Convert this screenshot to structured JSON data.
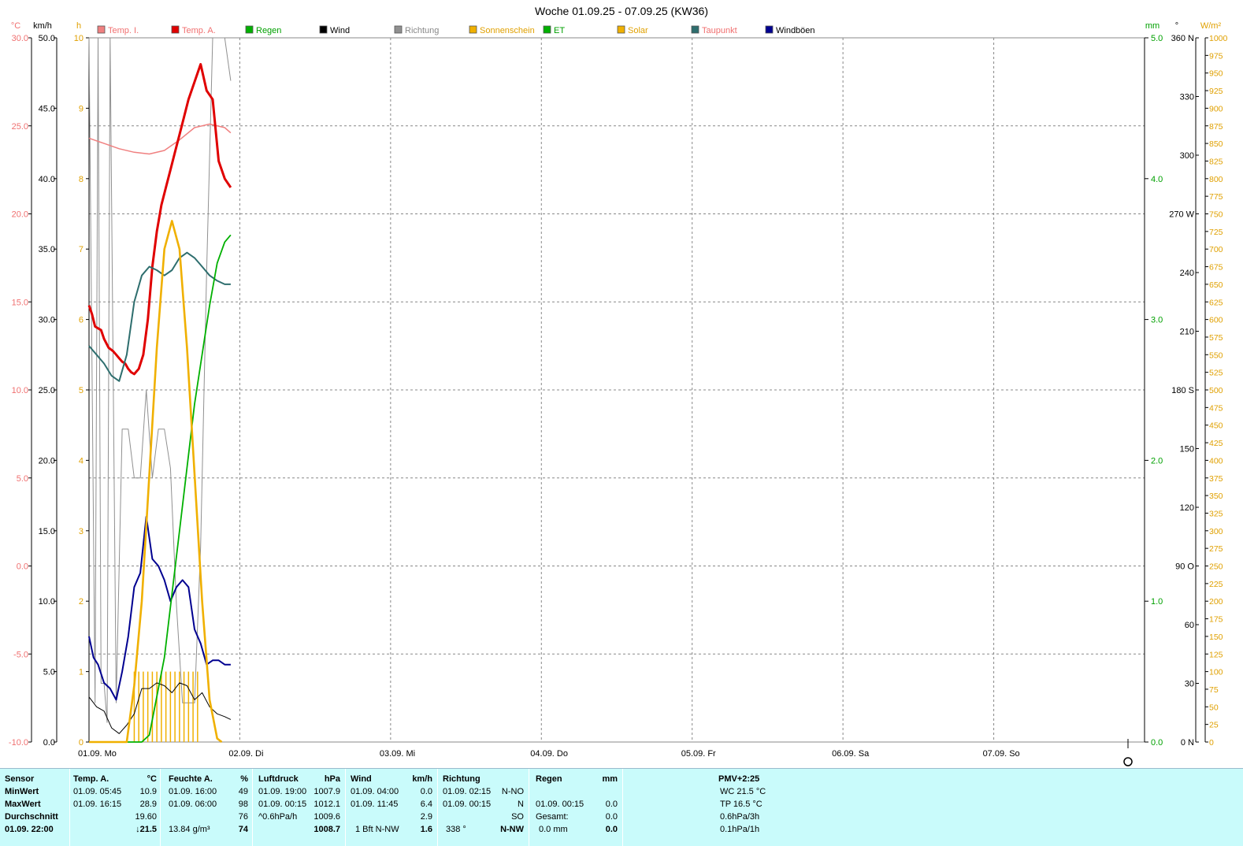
{
  "title": "Woche 01.09.25 - 07.09.25 (KW36)",
  "units": {
    "temp": "°C",
    "wind": "km/h",
    "hours": "h",
    "rain": "mm",
    "deg": "°",
    "solar": "W/m²"
  },
  "legend": [
    {
      "label": "Temp. I.",
      "color": "#f08080"
    },
    {
      "label": "Temp. A.",
      "color": "#e00000"
    },
    {
      "label": "Regen",
      "color": "#00b000"
    },
    {
      "label": "Wind",
      "color": "#000000"
    },
    {
      "label": "Richtung",
      "color": "#909090"
    },
    {
      "label": "Sonnenschein",
      "color": "#f0b000"
    },
    {
      "label": "ET",
      "color": "#00b000"
    },
    {
      "label": "Solar",
      "color": "#f0b000"
    },
    {
      "label": "Taupunkt",
      "color": "#2e6e6e"
    },
    {
      "label": "Windböen",
      "color": "#000090"
    }
  ],
  "chart_data": {
    "type": "line",
    "x_days": [
      "01.09.  Mo",
      "02.09.  Di",
      "03.09.  Mi",
      "04.09.  Do",
      "05.09.  Fr",
      "06.09.  Sa",
      "07.09.  So"
    ],
    "axes": {
      "temp": {
        "range": [
          -10,
          30
        ],
        "ticks": [
          "30.0",
          "25.0",
          "20.0",
          "15.0",
          "10.0",
          "5.0",
          "0.0",
          "-5.0",
          "-10.0"
        ]
      },
      "wind": {
        "range": [
          0,
          50
        ],
        "ticks": [
          "50.0",
          "45.0",
          "40.0",
          "35.0",
          "30.0",
          "25.0",
          "20.0",
          "15.0",
          "10.0",
          "5.0",
          "0.0"
        ]
      },
      "hours": {
        "range": [
          0,
          10
        ],
        "ticks": [
          "10",
          "9",
          "8",
          "7",
          "6",
          "5",
          "4",
          "3",
          "2",
          "1",
          "0"
        ]
      },
      "rain": {
        "range": [
          0,
          5
        ],
        "ticks": [
          "5.0",
          "4.0",
          "3.0",
          "2.0",
          "1.0",
          "0.0"
        ]
      },
      "direction": {
        "range": [
          0,
          360
        ],
        "ticks": [
          {
            "v": 360,
            "t": "360 N"
          },
          {
            "v": 330,
            "t": "330"
          },
          {
            "v": 300,
            "t": "300"
          },
          {
            "v": 270,
            "t": "270 W"
          },
          {
            "v": 240,
            "t": "240"
          },
          {
            "v": 210,
            "t": "210"
          },
          {
            "v": 180,
            "t": "180 S"
          },
          {
            "v": 150,
            "t": "150"
          },
          {
            "v": 120,
            "t": "120"
          },
          {
            "v": 90,
            "t": "90  O"
          },
          {
            "v": 60,
            "t": "60"
          },
          {
            "v": 30,
            "t": "30"
          },
          {
            "v": 0,
            "t": "0   N"
          }
        ]
      },
      "solar": {
        "range": [
          0,
          1000
        ],
        "step": 25
      }
    },
    "series": [
      {
        "name": "Temp. I.",
        "axis": "temp",
        "x": [
          0,
          0.1,
          0.2,
          0.3,
          0.4,
          0.5,
          0.6,
          0.7,
          0.8,
          0.9,
          0.94
        ],
        "values": [
          24.3,
          24.0,
          23.7,
          23.5,
          23.4,
          23.6,
          24.2,
          24.9,
          25.1,
          24.9,
          24.6
        ]
      },
      {
        "name": "Temp. A.",
        "axis": "temp",
        "x": [
          0,
          0.02,
          0.04,
          0.06,
          0.08,
          0.1,
          0.13,
          0.16,
          0.18,
          0.2,
          0.22,
          0.24,
          0.26,
          0.28,
          0.3,
          0.33,
          0.36,
          0.39,
          0.42,
          0.45,
          0.48,
          0.51,
          0.54,
          0.57,
          0.6,
          0.63,
          0.66,
          0.7,
          0.74,
          0.78,
          0.82,
          0.86,
          0.9,
          0.94
        ],
        "values": [
          14.8,
          14.3,
          13.6,
          13.5,
          13.4,
          12.9,
          12.4,
          12.2,
          12.0,
          11.8,
          11.6,
          11.5,
          11.2,
          11.0,
          10.9,
          11.2,
          12.0,
          14.0,
          17.0,
          19.0,
          20.5,
          21.5,
          22.5,
          23.5,
          24.5,
          25.5,
          26.5,
          27.5,
          28.5,
          27.0,
          26.5,
          23.0,
          22.0,
          21.5
        ]
      },
      {
        "name": "Taupunkt",
        "axis": "temp",
        "x": [
          0,
          0.05,
          0.1,
          0.15,
          0.2,
          0.25,
          0.3,
          0.35,
          0.4,
          0.45,
          0.5,
          0.55,
          0.6,
          0.65,
          0.7,
          0.75,
          0.8,
          0.85,
          0.9,
          0.94
        ],
        "values": [
          12.5,
          12.0,
          11.5,
          10.8,
          10.5,
          12.0,
          15.0,
          16.5,
          17.0,
          16.8,
          16.5,
          16.8,
          17.5,
          17.8,
          17.5,
          17.0,
          16.5,
          16.2,
          16.0,
          16.0
        ]
      },
      {
        "name": "ET",
        "axis": "rain",
        "x": [
          0,
          0.35,
          0.4,
          0.5,
          0.6,
          0.7,
          0.8,
          0.85,
          0.9,
          0.94
        ],
        "values": [
          0,
          0,
          0.05,
          0.6,
          1.5,
          2.4,
          3.1,
          3.4,
          3.55,
          3.6
        ]
      },
      {
        "name": "Solar",
        "axis": "solar",
        "x": [
          0,
          0.25,
          0.3,
          0.35,
          0.4,
          0.45,
          0.5,
          0.55,
          0.6,
          0.65,
          0.7,
          0.75,
          0.8,
          0.85,
          0.88
        ],
        "values": [
          0,
          0,
          80,
          200,
          380,
          560,
          700,
          740,
          700,
          560,
          380,
          200,
          60,
          5,
          0
        ]
      }
    ],
    "wind": {
      "axis": "wind",
      "x": [
        0,
        0.05,
        0.1,
        0.15,
        0.2,
        0.25,
        0.3,
        0.35,
        0.4,
        0.45,
        0.5,
        0.55,
        0.6,
        0.65,
        0.7,
        0.75,
        0.8,
        0.85,
        0.9,
        0.94
      ],
      "values": [
        3.2,
        2.5,
        2.2,
        1.0,
        0.6,
        1.2,
        2.0,
        3.8,
        3.8,
        4.2,
        4.0,
        3.5,
        4.2,
        4.0,
        3.0,
        3.5,
        2.5,
        2.0,
        1.8,
        1.6
      ]
    },
    "gusts": {
      "axis": "wind",
      "x": [
        0,
        0.03,
        0.06,
        0.1,
        0.14,
        0.18,
        0.22,
        0.26,
        0.3,
        0.34,
        0.38,
        0.42,
        0.46,
        0.5,
        0.54,
        0.58,
        0.62,
        0.66,
        0.7,
        0.74,
        0.78,
        0.82,
        0.86,
        0.9,
        0.94
      ],
      "values": [
        7.5,
        6.0,
        5.5,
        4.2,
        3.8,
        3.0,
        5.0,
        7.5,
        11.0,
        12.0,
        16.0,
        13.0,
        12.5,
        11.5,
        10.0,
        11.0,
        11.5,
        11.0,
        8.0,
        7.0,
        5.5,
        5.8,
        5.8,
        5.5,
        5.5
      ]
    },
    "direction": {
      "axis": "direction",
      "x": [
        0,
        0.04,
        0.06,
        0.08,
        0.1,
        0.12,
        0.14,
        0.18,
        0.22,
        0.26,
        0.3,
        0.34,
        0.38,
        0.42,
        0.46,
        0.5,
        0.54,
        0.58,
        0.62,
        0.66,
        0.7,
        0.74,
        0.78,
        0.82,
        0.86,
        0.9,
        0.94
      ],
      "values": [
        360,
        20,
        360,
        30,
        30,
        10,
        360,
        20,
        160,
        160,
        135,
        135,
        180,
        135,
        160,
        160,
        140,
        70,
        20,
        20,
        20,
        100,
        240,
        360,
        360,
        360,
        338
      ]
    },
    "sunshine": {
      "axis": "hours",
      "x_bars": [
        0.3,
        0.33,
        0.36,
        0.39,
        0.42,
        0.45,
        0.48,
        0.51,
        0.54,
        0.57,
        0.6,
        0.63,
        0.66,
        0.69,
        0.72
      ],
      "value": 1
    }
  },
  "table": {
    "sensor": {
      "head": "Sensor",
      "rows": [
        "MinWert",
        "MaxWert",
        "Durchschnitt",
        "01.09. 22:00"
      ]
    },
    "temp": {
      "head": "Temp. A.",
      "unit": "°C",
      "rows": [
        [
          "01.09.  05:45",
          "10.9"
        ],
        [
          "01.09.  16:15",
          "28.9"
        ],
        [
          "",
          "19.60"
        ],
        [
          "",
          "↓21.5"
        ]
      ]
    },
    "humid": {
      "head": "Feuchte A.",
      "unit": "%",
      "rows": [
        [
          "01.09.  16:00",
          "49"
        ],
        [
          "01.09.  06:00",
          "98"
        ],
        [
          "",
          "76"
        ],
        [
          "13.84 g/m³",
          "74"
        ]
      ]
    },
    "press": {
      "head": "Luftdruck",
      "unit": "hPa",
      "rows": [
        [
          "01.09.  19:00",
          "1007.9"
        ],
        [
          "01.09.  00:15",
          "1012.1"
        ],
        [
          "^0.6hPa/h",
          "1009.6"
        ],
        [
          "",
          "1008.7"
        ]
      ]
    },
    "wind": {
      "head": "Wind",
      "unit": "km/h",
      "rows": [
        [
          "01.09.  04:00",
          "0.0"
        ],
        [
          "01.09.  11:45",
          "6.4"
        ],
        [
          "",
          "2.9"
        ],
        [
          "1 Bft N-NW",
          "1.6"
        ]
      ]
    },
    "dir": {
      "head": "Richtung",
      "rows": [
        [
          "01.09.  02:15",
          "N-NO"
        ],
        [
          "01.09.  00:15",
          "N"
        ],
        [
          "",
          "SO"
        ],
        [
          "338 °",
          "N-NW"
        ]
      ]
    },
    "rain": {
      "head": "Regen",
      "unit": "mm",
      "rows": [
        [
          "",
          ""
        ],
        [
          "01.09.  00:15",
          "0.0"
        ],
        [
          "Gesamt:",
          "0.0"
        ],
        [
          "0.0 mm",
          "0.0"
        ]
      ]
    },
    "pmv": {
      "head": "PMV+2:25",
      "rows": [
        "WC 21.5 °C",
        "TP 16.5 °C",
        "0.6hPa/3h",
        "0.1hPa/1h"
      ]
    }
  }
}
